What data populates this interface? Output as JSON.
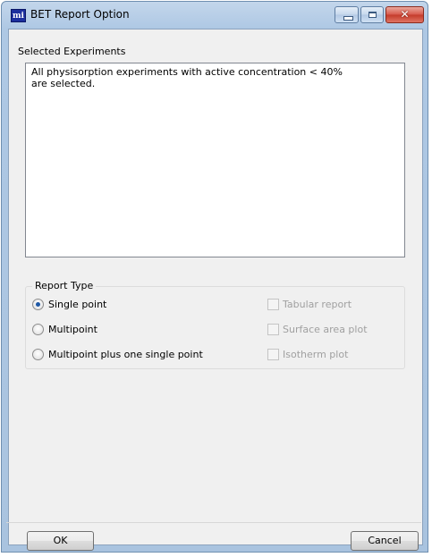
{
  "window": {
    "title": "BET Report Option",
    "app_icon_text": "mi",
    "controls": {
      "minimize": "minimize",
      "maximize": "maximize",
      "close": "✕"
    }
  },
  "experiments": {
    "label": "Selected Experiments",
    "lines": [
      "All physisorption experiments with active concentration < 40%",
      "are selected."
    ]
  },
  "report_type": {
    "label": "Report Type",
    "radios": [
      {
        "label": "Single point",
        "checked": true
      },
      {
        "label": "Multipoint",
        "checked": false
      },
      {
        "label": "Multipoint plus one single point",
        "checked": false
      }
    ],
    "checkboxes": [
      {
        "label": "Tabular report",
        "checked": false,
        "enabled": false
      },
      {
        "label": "Surface area plot",
        "checked": false,
        "enabled": false
      },
      {
        "label": "Isotherm plot",
        "checked": false,
        "enabled": false
      }
    ]
  },
  "buttons": {
    "ok": "OK",
    "cancel": "Cancel"
  },
  "colors": {
    "titlebar": "#aec8e4",
    "close_button": "#c33a2a",
    "radio_dot": "#1e58a6"
  }
}
